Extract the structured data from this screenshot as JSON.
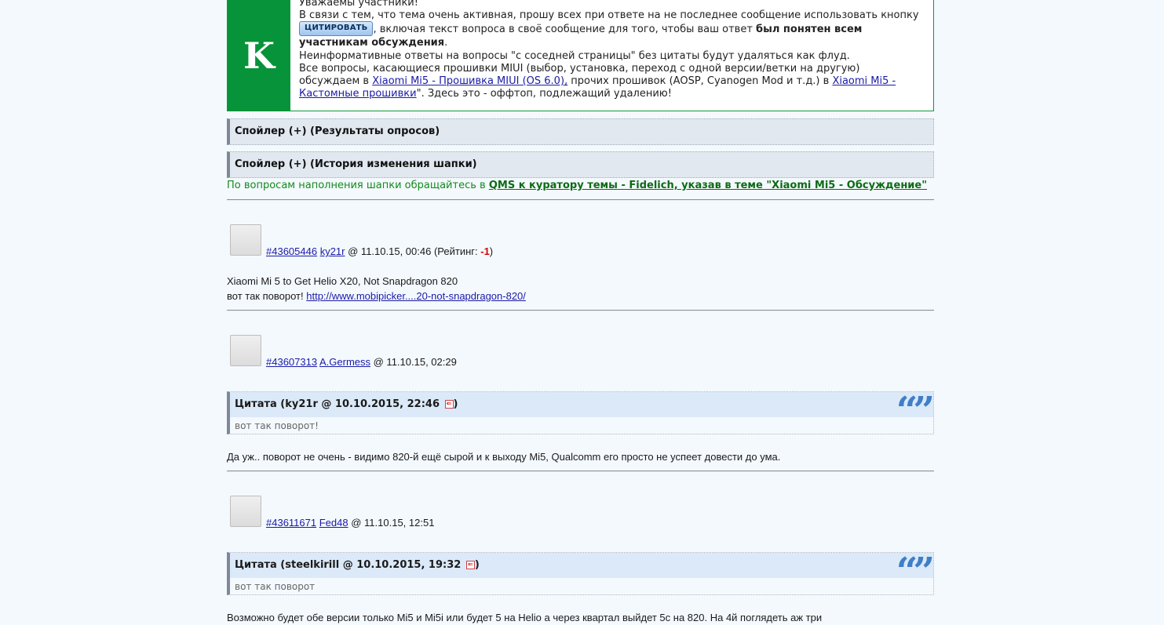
{
  "notice": {
    "badge_letter": "K",
    "line1": "Уважаемы участники!",
    "line2": "В связи с тем, что тема очень активная, прошу всех при ответе на не последнее сообщение использовать кнопку",
    "cite_button": "ЦИТИРОВАТЬ",
    "line3_after_button": ", включая текст вопроса в своё сообщение для того, чтобы ваш ответ",
    "line3_bold": "был понятен всем участникам обсуждения",
    "line3_end": ".",
    "line4": "Неинформативные ответы на вопросы \"с соседней страницы\" без цитаты будут удаляться как флуд.",
    "line5_start": "Все вопросы, касающиеся прошивки MIUI (выбор, установка, переход с одной версии/ветки на другую) обсуждаем в",
    "link1": "Xiaomi Mi5 - Прошивка MIUI (OS 6.0),",
    "line5_mid": " прочих прошивок (AOSP, Cyanogen Mod и т.д.) в",
    "link2": "Xiaomi Mi5 - Кастомные прошивки",
    "line5_end": "\". Здесь это - оффтоп, подлежащий удалению!"
  },
  "spoilers": [
    {
      "label": "Спойлер (+) (Результаты опросов)"
    },
    {
      "label": "Спойлер (+) (История изменения шапки)"
    }
  ],
  "green_note": {
    "text": "По вопросам наполнения шапки обращайтесь в",
    "link": "QMS к куратору темы - Fidelich, указав в теме \"Xiaomi Mi5 - Обсуждение\""
  },
  "posts": [
    {
      "id": "#43605446",
      "author": "ky21r",
      "date": "@ 11.10.15, 00:46",
      "rating_label": "(Рейтинг: ",
      "rating_value": "-1",
      "rating_close": ")",
      "body_line1": "Xiaomi Mi 5 to Get Helio X20, Not Snapdragon 820",
      "body_line2": "вот так поворот!",
      "body_link": "http://www.mobipicker....20-not-snapdragon-820/"
    },
    {
      "id": "#43607313",
      "author": "A.Germess",
      "date": "@ 11.10.15, 02:29",
      "quote_title": "Цитата (ky21r @ 10.10.2015, 22:46",
      "quote_close": ")",
      "quote_text": "вот так поворот!",
      "body_line1": "Да уж.. поворот не очень - видимо 820-й ещё сырой и к выходу Mi5, Qualcomm его просто не успеет довести до ума."
    },
    {
      "id": "#43611671",
      "author": "Fed48",
      "date": "@ 11.10.15, 12:51",
      "quote_title": "Цитата (steelkirill @ 10.10.2015, 19:32",
      "quote_close": ")",
      "quote_text": "вот так поворот",
      "body_line1": "Возможно будет обе версии только Mi5 и Mi5i или будет 5 на Helio а через квартал выйдет 5с на 820. На 4й поглядеть аж три"
    }
  ],
  "icons": {
    "quote_mark": "“”",
    "jump": "⇐"
  }
}
